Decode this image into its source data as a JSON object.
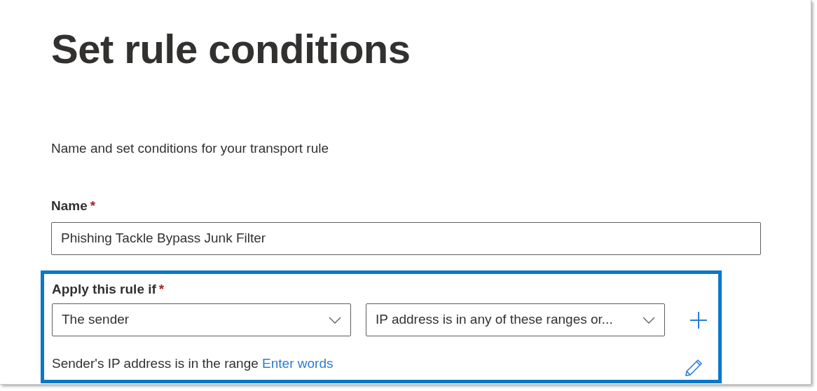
{
  "title": "Set rule conditions",
  "description": "Name and set conditions for your transport rule",
  "name_field": {
    "label": "Name",
    "required_mark": "*",
    "value": "Phishing Tackle Bypass Junk Filter"
  },
  "condition": {
    "label": "Apply this rule if",
    "required_mark": "*",
    "highlighted": true,
    "dropdowns": [
      {
        "value": "The sender"
      },
      {
        "value": "IP address is in any of these ranges or..."
      }
    ],
    "summary": "Sender's IP address is in the range",
    "link": "Enter words"
  }
}
